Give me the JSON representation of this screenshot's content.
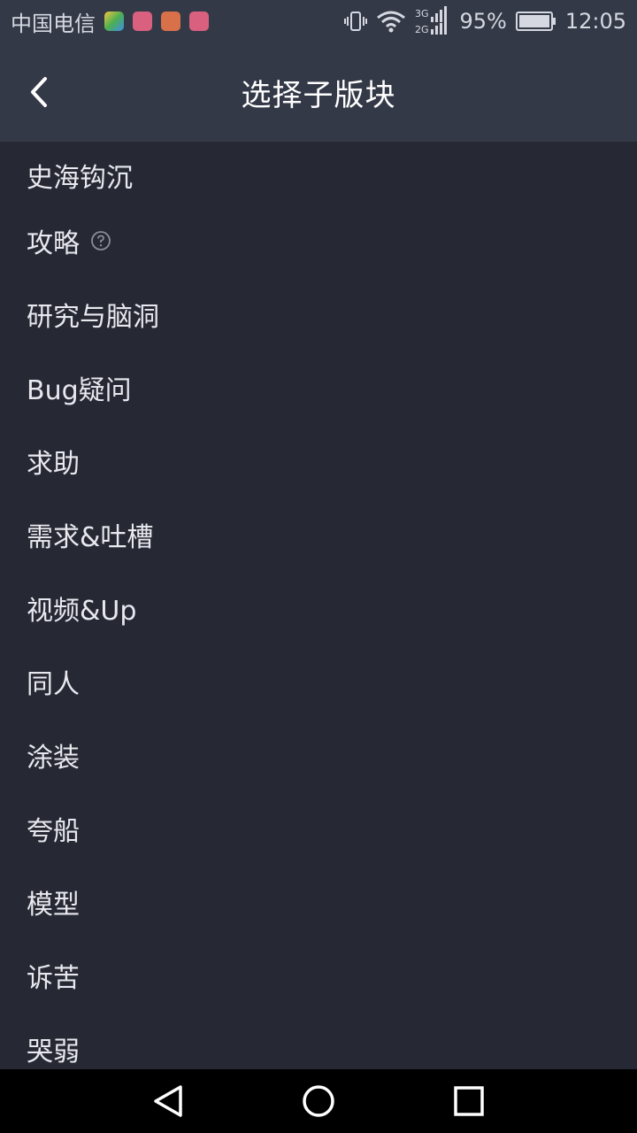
{
  "status_bar": {
    "carrier": "中国电信",
    "battery": "95%",
    "time": "12:05",
    "network": "3G 2G",
    "app_icon_colors": [
      "#4caf50",
      "#e0608a",
      "#e07a50",
      "#e0608a"
    ]
  },
  "header": {
    "title": "选择子版块"
  },
  "list": {
    "items": [
      {
        "label": "史海钩沉"
      },
      {
        "label": "攻略",
        "has_help_icon": true
      },
      {
        "label": "研究与脑洞"
      },
      {
        "label": "Bug疑问"
      },
      {
        "label": "求助"
      },
      {
        "label": "需求&吐槽"
      },
      {
        "label": "视频&Up"
      },
      {
        "label": "同人"
      },
      {
        "label": "涂装"
      },
      {
        "label": "夸船"
      },
      {
        "label": "模型"
      },
      {
        "label": "诉苦"
      },
      {
        "label": "哭弱"
      }
    ]
  },
  "colors": {
    "header_bg": "#343947",
    "list_bg": "#262834",
    "nav_bg": "#000000"
  }
}
